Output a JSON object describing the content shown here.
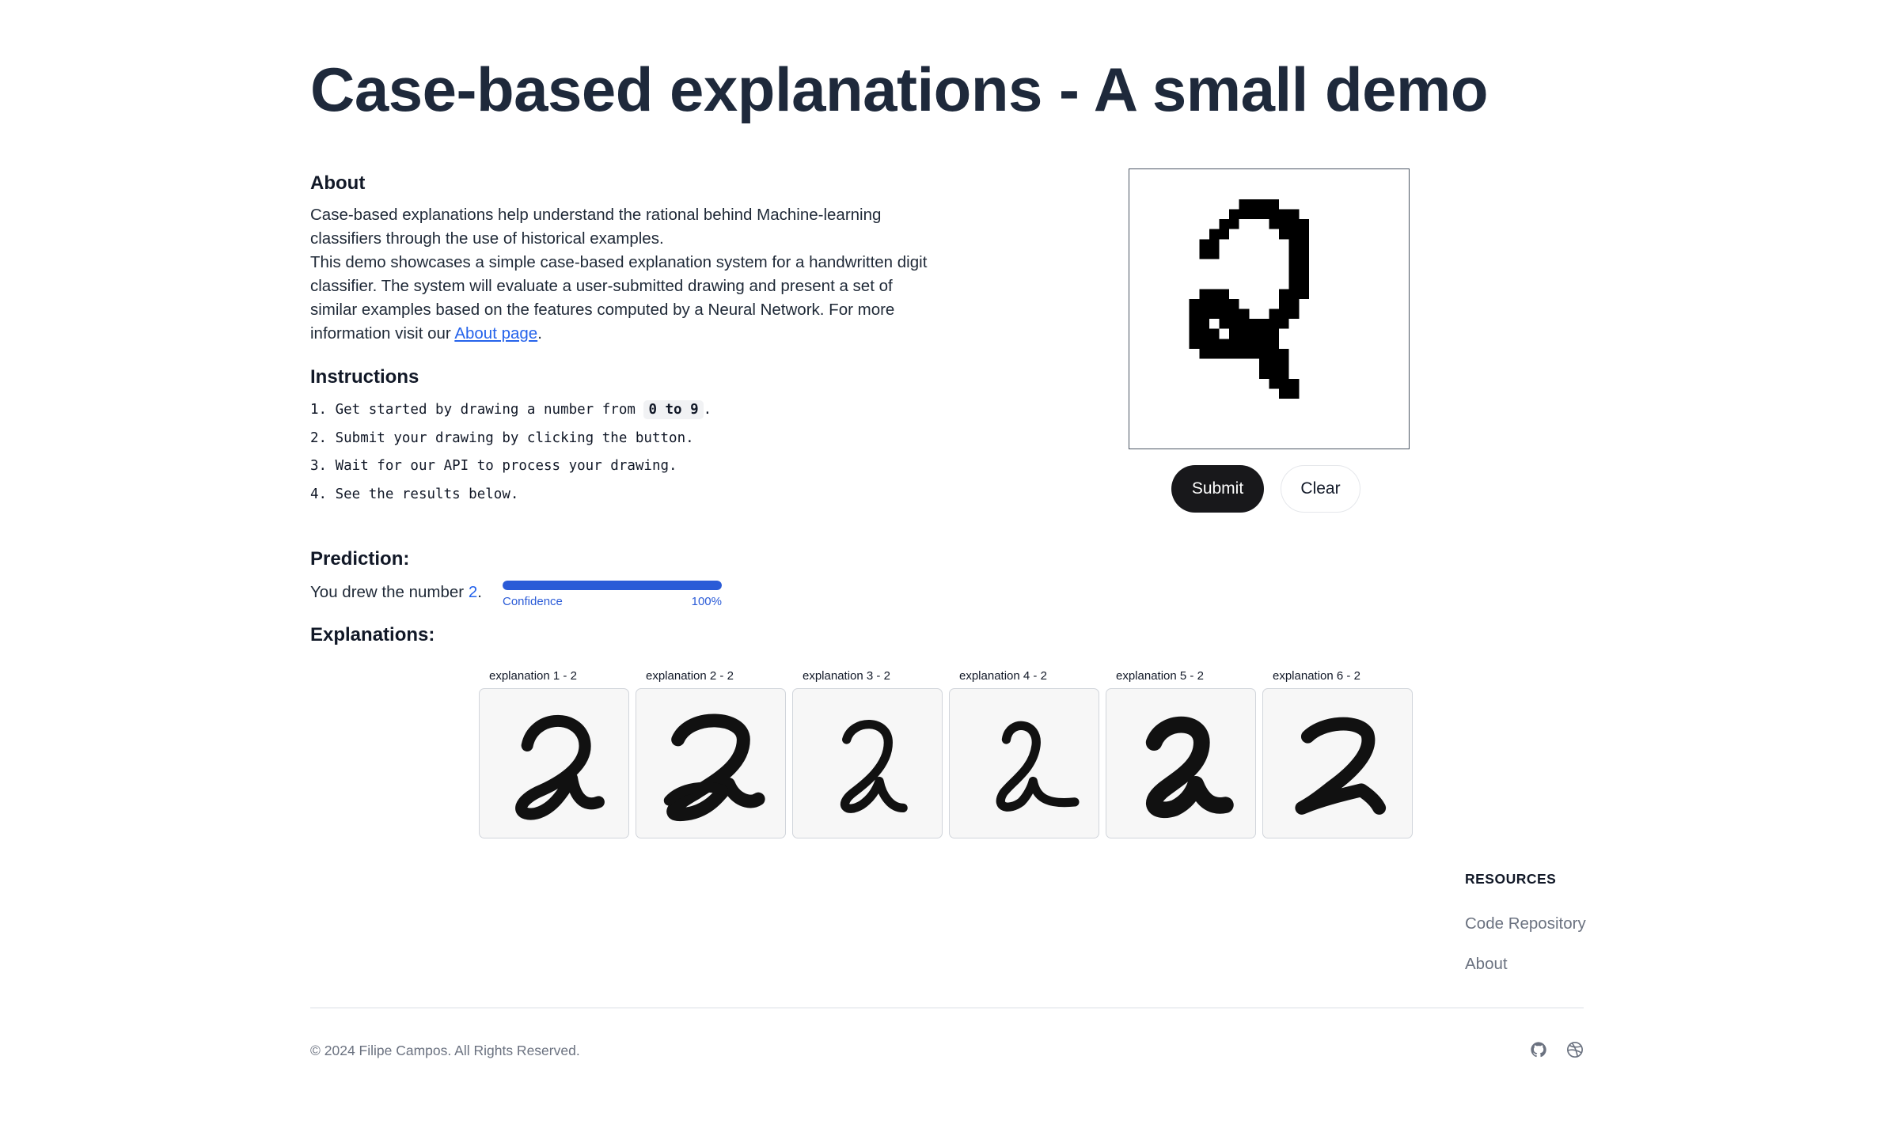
{
  "page": {
    "title": "Case-based explanations - A small demo"
  },
  "about": {
    "heading": "About",
    "paragraph1": "Case-based explanations help understand the rational behind Machine-learning classifiers through the use of historical examples.",
    "paragraph2": "This demo showcases a simple case-based explanation system for a handwritten digit classifier. The system will evaluate a user-submitted drawing and present a set of similar examples based on the features computed by a Neural Network. For more information visit our ",
    "link_text": "About page",
    "paragraph2_end": "."
  },
  "instructions": {
    "heading": "Instructions",
    "step1_prefix": "1. Get started by drawing a number from ",
    "step1_code": "0 to 9",
    "step1_suffix": ".",
    "step2": "2. Submit your drawing by clicking the button.",
    "step3": "3. Wait for our API to process your drawing.",
    "step4": "4. See the results below."
  },
  "canvas": {
    "drawn_digit": "2"
  },
  "buttons": {
    "submit_label": "Submit",
    "clear_label": "Clear"
  },
  "prediction": {
    "heading": "Prediction:",
    "text_prefix": "You drew the number ",
    "number": "2",
    "text_suffix": ".",
    "confidence_label": "Confidence",
    "confidence_value": 100,
    "confidence_text": "100%",
    "accent_color": "#2a5bd7"
  },
  "explanations": {
    "heading": "Explanations:",
    "items": [
      {
        "label": "explanation 1 - 2"
      },
      {
        "label": "explanation 2 - 2"
      },
      {
        "label": "explanation 3 - 2"
      },
      {
        "label": "explanation 4 - 2"
      },
      {
        "label": "explanation 5 - 2"
      },
      {
        "label": "explanation 6 - 2"
      }
    ]
  },
  "footer": {
    "resources_heading": "RESOURCES",
    "links": [
      "Code Repository",
      "About"
    ],
    "copyright": "© 2024 Filipe Campos. All Rights Reserved.",
    "icons": [
      "github-icon",
      "dribbble-icon"
    ]
  }
}
